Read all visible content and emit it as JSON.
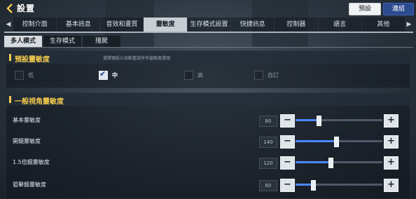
{
  "header": {
    "title": "設置",
    "default_label": "預設",
    "connect_label": "連結",
    "back_icon": "back-arrow-icon"
  },
  "tabs": {
    "items": [
      "控制介面",
      "基本訊息",
      "音效和畫質",
      "靈敏度",
      "生存模式設置",
      "快捷訊息",
      "控制器",
      "語言",
      "其他"
    ],
    "active_index": 3,
    "left_arrow": "◀",
    "right_arrow": "▶"
  },
  "subtabs": {
    "items": [
      "多人模式",
      "生存模式",
      "殭屍"
    ],
    "active_index": 0
  },
  "preset": {
    "title": "預設靈敏度",
    "hint": "選擇預設以自動重設所有靈敏度選項",
    "options": [
      {
        "label": "低",
        "checked": false
      },
      {
        "label": "中",
        "checked": true
      },
      {
        "label": "高",
        "checked": false
      },
      {
        "label": "自訂",
        "checked": false
      }
    ]
  },
  "general": {
    "title": "一般視角靈敏度",
    "minus_symbol": "−",
    "plus_symbol": "+",
    "rows": [
      {
        "label": "基本靈敏度",
        "value": "80",
        "level": 0.27
      },
      {
        "label": "開鏡靈敏度",
        "value": "140",
        "level": 0.47
      },
      {
        "label": "1.5倍鏡靈敏度",
        "value": "120",
        "level": 0.4
      },
      {
        "label": "狙擊鏡靈敏度",
        "value": "60",
        "level": 0.2
      }
    ]
  },
  "colors": {
    "accent_yellow": "#f2c94c",
    "slider_fill": "#4a87ff",
    "connect_button": "#2c4a8f"
  }
}
